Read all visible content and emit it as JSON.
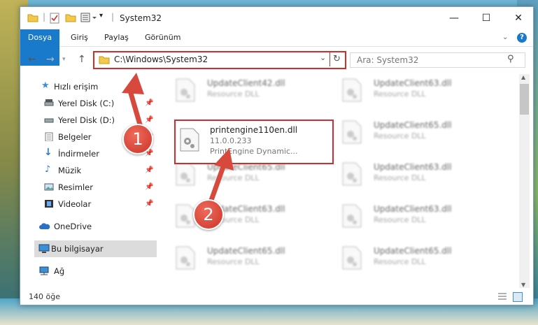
{
  "window": {
    "title": "System32"
  },
  "ribbon": {
    "tabs": [
      "Dosya",
      "Giriş",
      "Paylaş",
      "Görünüm"
    ]
  },
  "address": {
    "path": "C:\\Windows\\System32"
  },
  "search": {
    "placeholder": "Ara: System32"
  },
  "sidebar": {
    "items": [
      {
        "label": "Hızlı erişim",
        "icon": "star-icon"
      },
      {
        "label": "Yerel Disk (C:)",
        "icon": "drive-icon"
      },
      {
        "label": "Yerel Disk (D:)",
        "icon": "drive-icon"
      },
      {
        "label": "Belgeler",
        "icon": "documents-icon"
      },
      {
        "label": "İndirmeler",
        "icon": "download-icon"
      },
      {
        "label": "Müzik",
        "icon": "music-icon"
      },
      {
        "label": "Resimler",
        "icon": "pictures-icon"
      },
      {
        "label": "Videolar",
        "icon": "video-icon"
      },
      {
        "label": "OneDrive",
        "icon": "cloud-icon"
      },
      {
        "label": "Bu bilgisayar",
        "icon": "computer-icon"
      },
      {
        "label": "Ağ",
        "icon": "network-icon"
      }
    ]
  },
  "files": {
    "left": [
      {
        "name": "UpdateClient42.dll",
        "desc": "Resource DLL"
      },
      {
        "name": "printengine110en.dll",
        "desc": "11.0.0.233",
        "desc2": "PrintEngine Dynamic..."
      },
      {
        "name": "UpdateClient65.dll",
        "desc": "Resource DLL"
      },
      {
        "name": "UpdateClient63.dll",
        "desc": "Resource DLL"
      },
      {
        "name": "UpdateClient65.dll",
        "desc": "Resource DLL"
      }
    ],
    "right": [
      {
        "name": "UpdateClient63.dll",
        "desc": "Resource DLL"
      },
      {
        "name": "UpdateClient65.dll",
        "desc": "Resource DLL"
      },
      {
        "name": "UpdateClient63.dll",
        "desc": "Resource DLL"
      },
      {
        "name": "UpdateClient63.dll",
        "desc": "Resource DLL"
      },
      {
        "name": "UpdateClient65.dll",
        "desc": "Resource DLL"
      }
    ]
  },
  "status": {
    "count": "140 öğe"
  },
  "annotations": [
    "1",
    "2"
  ],
  "colors": {
    "accent": "#1979ca",
    "highlight": "#d22d2d",
    "arrow": "#d8493d"
  }
}
